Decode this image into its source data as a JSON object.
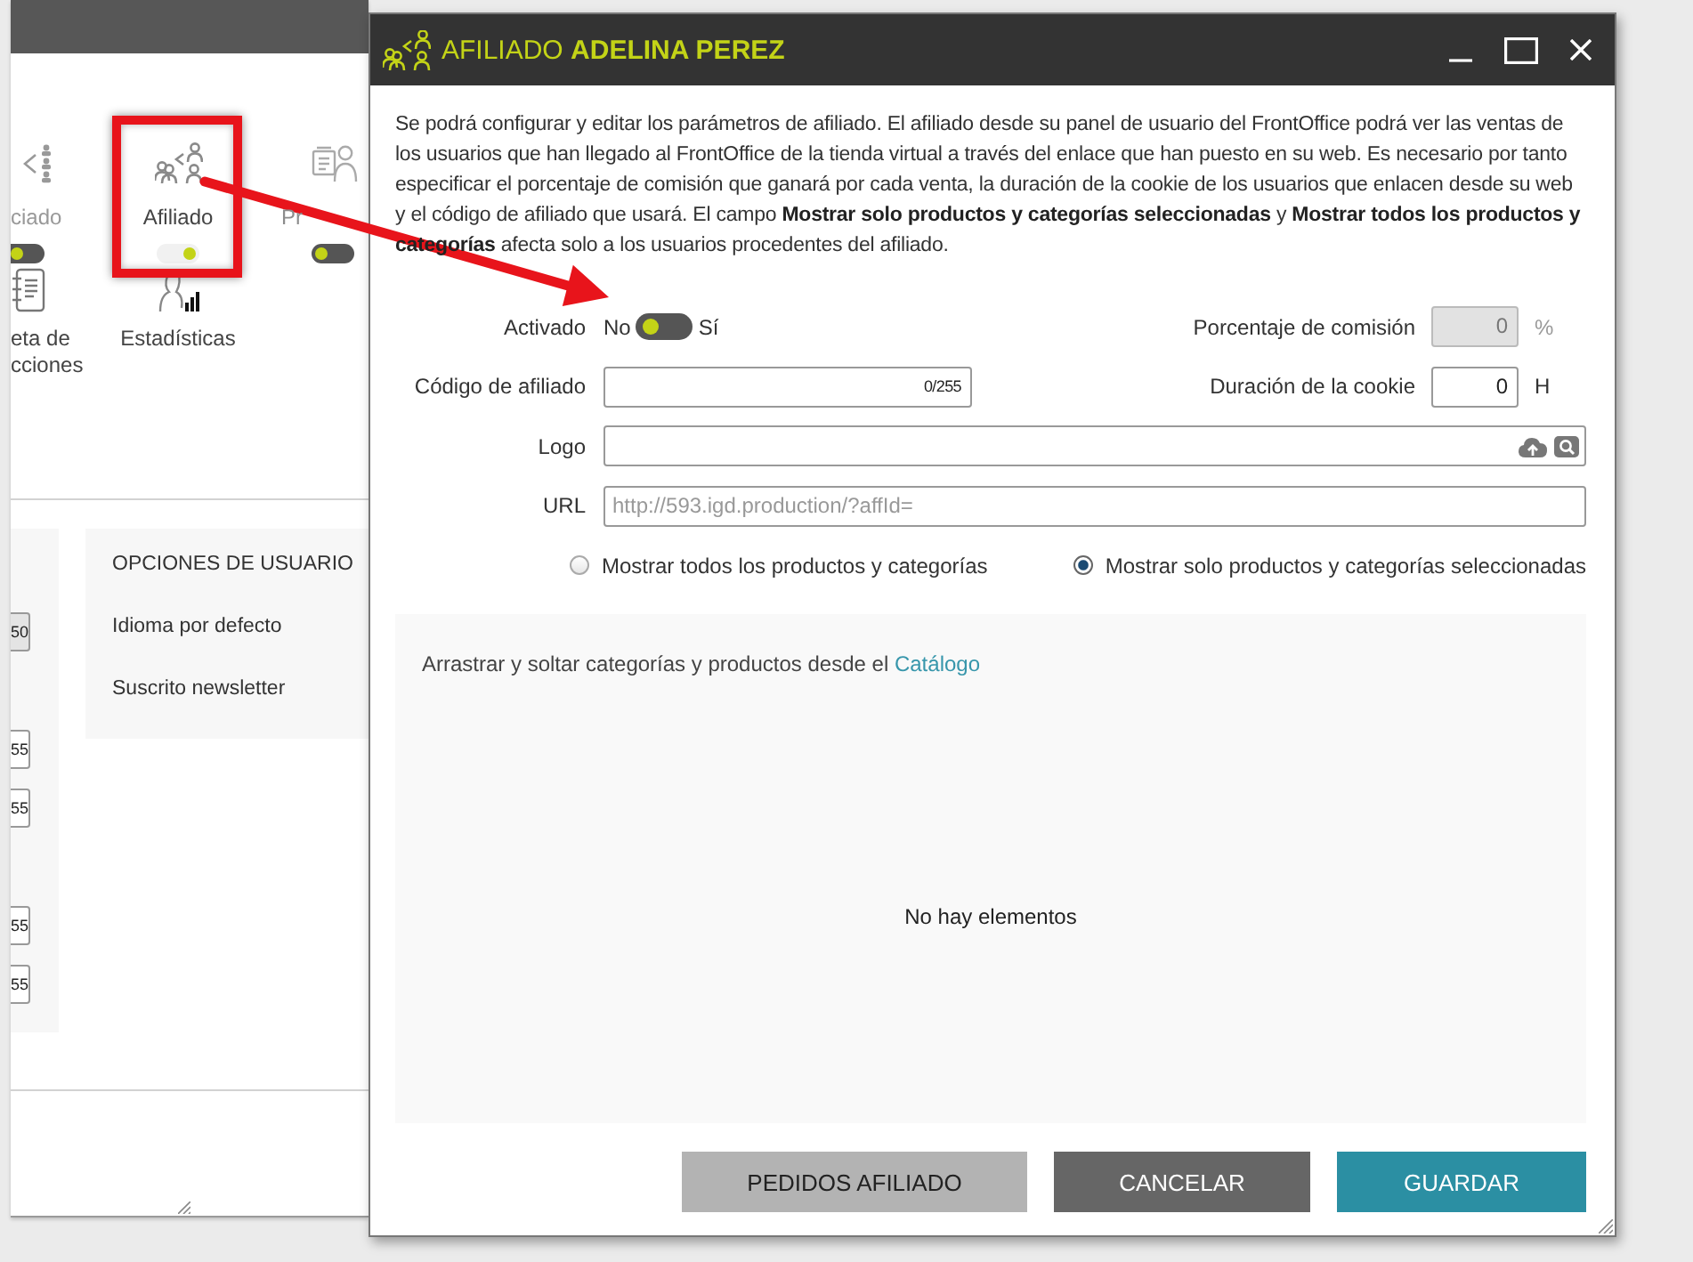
{
  "background_window": {
    "module_row_1": [
      {
        "kind": "associate",
        "label": "ciado",
        "on": false
      },
      {
        "kind": "affiliate",
        "label": "Afiliado",
        "on": true
      },
      {
        "kind": "provider",
        "label": "Pr",
        "on": false
      }
    ],
    "module_row_2": [
      {
        "kind": "notebook",
        "label": "eta de cciones"
      },
      {
        "kind": "stats",
        "label": "Estadísticas"
      }
    ],
    "left_panel": [
      {
        "value": "50",
        "disabled": true
      },
      {
        "value": "55",
        "disabled": false
      },
      {
        "value": "55",
        "disabled": false
      },
      {
        "value": "55",
        "disabled": false
      },
      {
        "value": "55",
        "disabled": false
      }
    ],
    "user_options": {
      "title": "OPCIONES DE USUARIO",
      "items": [
        "Idioma por defecto",
        "Suscrito newsletter"
      ]
    }
  },
  "dialog": {
    "title": "AFILIADO **ADELINA PEREZ**",
    "description": "Se podrá configurar y editar los parámetros de afiliado. El afiliado desde su panel de usuario del FrontOffice podrá ver las ventas de los usuarios que han llegado al FrontOffice de la tienda virtual a través del enlace que han puesto en su web. Es necesario por tanto especificar el porcentaje de comisión que ganará por cada venta, la duración de la cookie de los usuarios que enlacen desde su web y el código de afiliado que usará. El campo **Mostrar solo productos y categorías seleccionadas** y **Mostrar todos los productos y categorías** afecta solo a los usuarios procedentes del afiliado.",
    "form": {
      "activated": {
        "label": "Activado",
        "off_label": "No",
        "on_label": "Sí",
        "on": false
      },
      "commission": {
        "label": "Porcentaje de comisión",
        "value": "0",
        "unit": "%",
        "disabled": true
      },
      "code": {
        "label": "Código de afiliado",
        "counter": "0/255"
      },
      "cookie": {
        "label": "Duración de la cookie",
        "value": "0",
        "unit": "H",
        "disabled": false
      },
      "logo": {
        "label": "Logo"
      },
      "url": {
        "label": "URL",
        "placeholder": "http://593.igd.production/?affId="
      }
    },
    "radios": [
      {
        "label": "Mostrar todos los productos y categorías",
        "selected": false
      },
      {
        "label": "Mostrar solo productos y categorías seleccionadas",
        "selected": true
      }
    ],
    "drop_area": {
      "hint": "Arrastrar y soltar categorías y productos desde el",
      "link": "Catálogo",
      "empty": "No hay elementos"
    },
    "buttons": [
      {
        "label": "PEDIDOS AFILIADO",
        "kind": "secondary"
      },
      {
        "label": "CANCELAR",
        "kind": "cancel"
      },
      {
        "label": "GUARDAR",
        "kind": "primary"
      }
    ]
  }
}
